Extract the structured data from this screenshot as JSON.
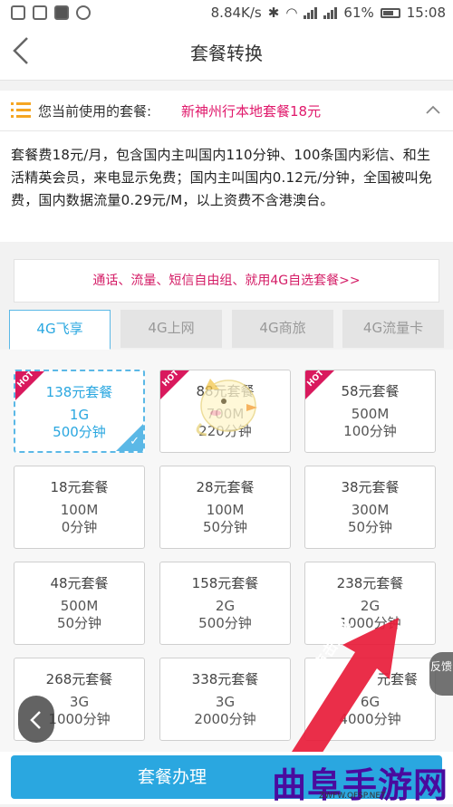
{
  "status_bar": {
    "speed": "8.84K/s",
    "battery": "61%",
    "time": "15:08"
  },
  "header": {
    "title": "套餐转换"
  },
  "current": {
    "label": "您当前使用的套餐:",
    "plan_name": "新神州行本地套餐18元"
  },
  "description": "套餐费18元/月，包含国内主叫国内110分钟、100条国内彩信、和生活精英会员，来电显示免费；国内主叫国内0.12元/分钟，全国被叫免费，国内数据流量0.29元/M，以上资费不含港澳台。",
  "self_select": "通话、流量、短信自由组、就用4G自选套餐>>",
  "tabs": [
    {
      "label": "4G飞享"
    },
    {
      "label": "4G上网"
    },
    {
      "label": "4G商旅"
    },
    {
      "label": "4G流量卡"
    }
  ],
  "cards": [
    {
      "name": "138元套餐",
      "data": "1G",
      "voice": "500分钟",
      "hot": "HOT"
    },
    {
      "name": "88元套餐",
      "data": "700M",
      "voice": "220分钟",
      "hot": "HOT"
    },
    {
      "name": "58元套餐",
      "data": "500M",
      "voice": "100分钟",
      "hot": "HOT"
    },
    {
      "name": "18元套餐",
      "data": "100M",
      "voice": "0分钟"
    },
    {
      "name": "28元套餐",
      "data": "100M",
      "voice": "50分钟"
    },
    {
      "name": "38元套餐",
      "data": "300M",
      "voice": "50分钟"
    },
    {
      "name": "48元套餐",
      "data": "500M",
      "voice": "50分钟"
    },
    {
      "name": "158元套餐",
      "data": "2G",
      "voice": "500分钟"
    },
    {
      "name": "238元套餐",
      "data": "2G",
      "voice": "1000分钟"
    },
    {
      "name": "268元套餐",
      "data": "3G",
      "voice": "1000分钟"
    },
    {
      "name": "338元套餐",
      "data": "3G",
      "voice": "2000分钟"
    },
    {
      "name": "元套餐",
      "data": "6G",
      "voice": "4000分钟"
    }
  ],
  "feedback": "反馈",
  "annotation": "点击此处",
  "submit": "套餐办理",
  "watermark": {
    "text": "曲阜手游网",
    "url": "ZWFW.QFSP.NET"
  },
  "colors": {
    "accent": "#2aa7e0",
    "highlight": "#e0196b",
    "hot": "#d9195d"
  }
}
